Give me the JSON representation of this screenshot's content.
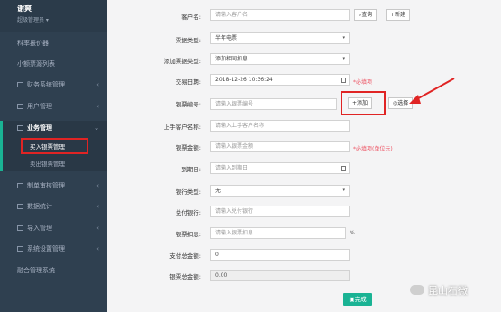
{
  "sidebar": {
    "brand_name": "谢爽",
    "brand_role": "超级管理员 ▾",
    "items": [
      {
        "label": "科率报价器"
      },
      {
        "label": "小额票源列表"
      },
      {
        "label": "财务系统管理"
      },
      {
        "label": "用户管理"
      },
      {
        "label": "业务管理"
      },
      {
        "label": "制单审核管理"
      },
      {
        "label": "数据统计"
      },
      {
        "label": "导入管理"
      },
      {
        "label": "系统设置管理"
      },
      {
        "label": "融合管理系统"
      }
    ],
    "sub_items": [
      {
        "label": "买入银票管理"
      },
      {
        "label": "卖出银票管理"
      }
    ]
  },
  "form": {
    "customer": {
      "label": "客户名:",
      "placeholder": "请输入客户名",
      "query_btn": "查询",
      "new_btn": "新建"
    },
    "ticket_type": {
      "label": "票据类型:",
      "value": "半年电票"
    },
    "add_type": {
      "label": "添加票据类型:",
      "value": "添加相同扣息"
    },
    "trade_date": {
      "label": "交易日期:",
      "value": "2018-12-26 10:36:24",
      "required": "*必填项"
    },
    "ticket_no": {
      "label": "银票编号:",
      "placeholder": "请输入银票编号",
      "add_btn": "添加",
      "select_btn": "选择"
    },
    "upper_customer": {
      "label": "上手客户名称:",
      "placeholder": "请输入上手客户名称"
    },
    "amount": {
      "label": "银票金额:",
      "placeholder": "请输入银票金额",
      "required": "*必填项(单位元)"
    },
    "due_date": {
      "label": "到期日:",
      "placeholder": "请输入到期日"
    },
    "bank_type": {
      "label": "银行类型:",
      "value": "无"
    },
    "pay_bank": {
      "label": "兑付银行:",
      "placeholder": "请输入兑付银行"
    },
    "discount": {
      "label": "银票扣息:",
      "placeholder": "请输入银票扣息",
      "unit": "%"
    },
    "pay_total": {
      "label": "支付总金额:",
      "value": "0"
    },
    "ticket_total": {
      "label": "银票总金额:",
      "value": "0.00"
    },
    "complete_btn": "完成"
  },
  "watermark": "昆山石微",
  "colors": {
    "sidebar_bg": "#2f4050",
    "accent": "#1ab394",
    "required": "#ed5565",
    "highlight": "#e02424"
  }
}
